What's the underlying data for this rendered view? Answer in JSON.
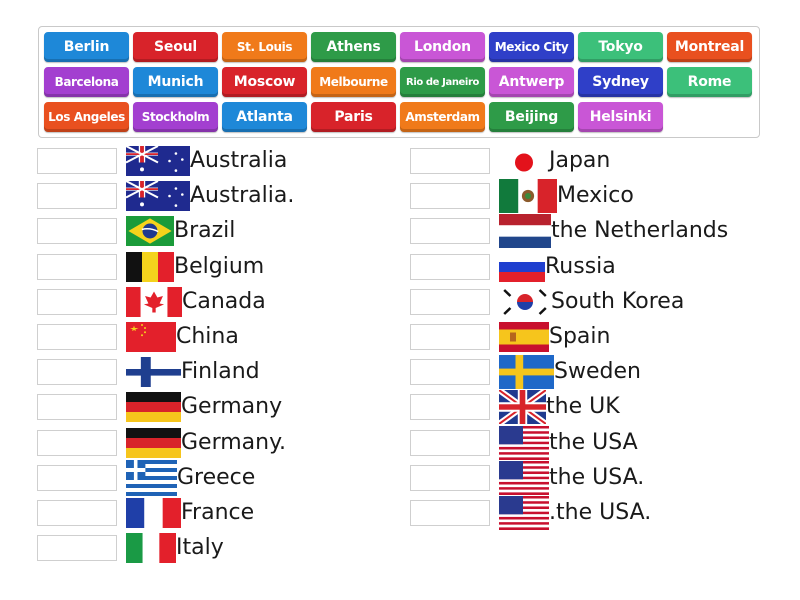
{
  "word_bank": [
    {
      "label": "Berlin",
      "color": "#1E88D8"
    },
    {
      "label": "Seoul",
      "color": "#D8232A"
    },
    {
      "label": "St. Louis",
      "color": "#F07A1A"
    },
    {
      "label": "Athens",
      "color": "#2E9B48"
    },
    {
      "label": "London",
      "color": "#C956D6"
    },
    {
      "label": "Mexico City",
      "color": "#2F3FC8"
    },
    {
      "label": "Tokyo",
      "color": "#3CC07A"
    },
    {
      "label": "Montreal",
      "color": "#E9501F"
    },
    {
      "label": "Barcelona",
      "color": "#A33FD0"
    },
    {
      "label": "Munich",
      "color": "#1E88D8"
    },
    {
      "label": "Moscow",
      "color": "#D8232A"
    },
    {
      "label": "Melbourne",
      "color": "#F07A1A"
    },
    {
      "label": "Rio de Janeiro",
      "color": "#2E9B48"
    },
    {
      "label": "Antwerp",
      "color": "#C956D6"
    },
    {
      "label": "Sydney",
      "color": "#2F3FC8"
    },
    {
      "label": "Rome",
      "color": "#3CC07A"
    },
    {
      "label": "Los Angeles",
      "color": "#E9501F"
    },
    {
      "label": "Stockholm",
      "color": "#A33FD0"
    },
    {
      "label": "Atlanta",
      "color": "#1E88D8"
    },
    {
      "label": "Paris",
      "color": "#D8232A"
    },
    {
      "label": "Amsterdam",
      "color": "#F07A1A"
    },
    {
      "label": "Beijing",
      "color": "#2E9B48"
    },
    {
      "label": "Helsinki",
      "color": "#C956D6"
    }
  ],
  "left_column": [
    {
      "country": "Australia",
      "flag": "australia-flag-icon"
    },
    {
      "country": "Australia.",
      "flag": "australia-flag-icon"
    },
    {
      "country": "Brazil",
      "flag": "brazil-flag-icon"
    },
    {
      "country": "Belgium",
      "flag": "belgium-flag-icon"
    },
    {
      "country": "Canada",
      "flag": "canada-flag-icon"
    },
    {
      "country": "China",
      "flag": "china-flag-icon"
    },
    {
      "country": "Finland",
      "flag": "finland-flag-icon"
    },
    {
      "country": "Germany",
      "flag": "germany-flag-icon"
    },
    {
      "country": "Germany.",
      "flag": "germany-flag-icon"
    },
    {
      "country": "Greece",
      "flag": "greece-flag-icon"
    },
    {
      "country": "France",
      "flag": "france-flag-icon"
    },
    {
      "country": "Italy",
      "flag": "italy-flag-icon"
    }
  ],
  "right_column": [
    {
      "country": "Japan",
      "flag": "japan-flag-icon"
    },
    {
      "country": "Mexico",
      "flag": "mexico-flag-icon"
    },
    {
      "country": "the Netherlands",
      "flag": "netherlands-flag-icon"
    },
    {
      "country": "Russia",
      "flag": "russia-flag-icon"
    },
    {
      "country": "South Korea",
      "flag": "south-korea-flag-icon"
    },
    {
      "country": "Spain",
      "flag": "spain-flag-icon"
    },
    {
      "country": "Sweden",
      "flag": "sweden-flag-icon"
    },
    {
      "country": "the UK",
      "flag": "uk-flag-icon"
    },
    {
      "country": "the USA",
      "flag": "usa-flag-icon"
    },
    {
      "country": "the USA.",
      "flag": "usa-flag-icon"
    },
    {
      "country": ".the USA.",
      "flag": "usa-flag-icon"
    }
  ]
}
